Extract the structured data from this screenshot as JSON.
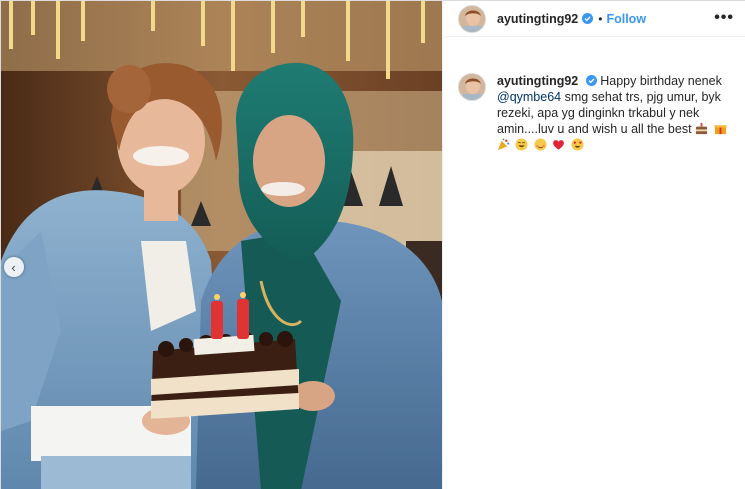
{
  "post": {
    "photo_alt": "",
    "carousel_prev_glyph": "‹"
  },
  "header": {
    "username": "ayutingting92",
    "separator": "•",
    "follow_label": "Follow",
    "more_glyph": "•••"
  },
  "caption": {
    "username": "ayutingting92",
    "text_before_mention": "Happy birthday nenek ",
    "mention": "@qymbe64",
    "text_after_mention": " smg sehat trs, pjg umur, byk rezeki, apa yg dinginkn trkabul y nek amin....luv u and wish u all the best ",
    "emojis": [
      "cake-emoji",
      "gift-emoji",
      "party-popper-emoji",
      "smiling-eyes-emoji",
      "blush-emoji",
      "red-heart-emoji",
      "heart-eyes-emoji"
    ]
  },
  "colors": {
    "link_blue": "#3897f0",
    "mention_blue": "#003569",
    "verified_blue": "#3897f0",
    "border": "#dbdbdb"
  }
}
